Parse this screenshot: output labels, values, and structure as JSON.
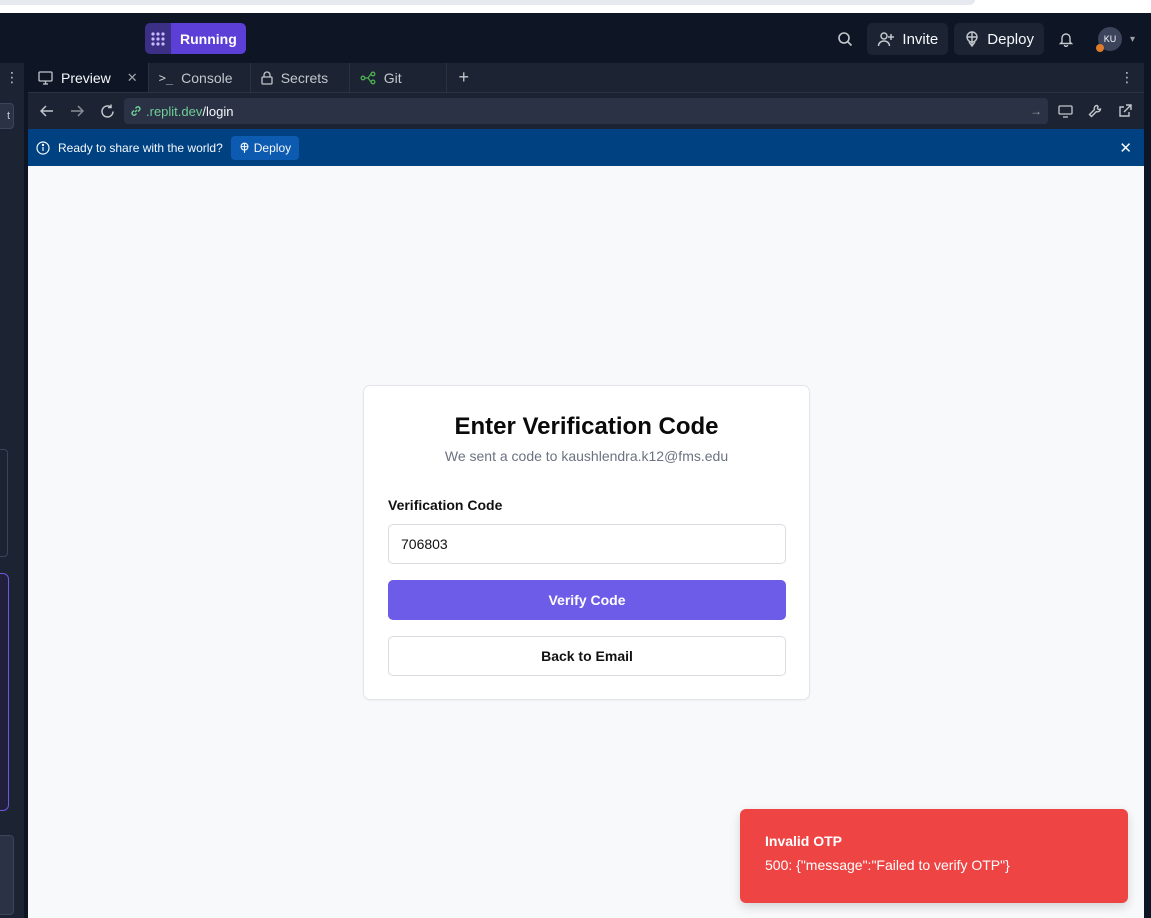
{
  "header": {
    "run_label": "Running",
    "invite_label": "Invite",
    "deploy_label": "Deploy",
    "avatar_initials": "KU"
  },
  "tabs": [
    {
      "label": "Preview",
      "icon": "monitor-icon"
    },
    {
      "label": "Console",
      "icon": "terminal-icon"
    },
    {
      "label": "Secrets",
      "icon": "lock-icon"
    },
    {
      "label": "Git",
      "icon": "git-icon"
    }
  ],
  "url": {
    "host": ".replit.dev",
    "path": "/login"
  },
  "banner": {
    "text": "Ready to share with the world?",
    "deploy_label": "Deploy"
  },
  "card": {
    "title": "Enter Verification Code",
    "subtitle": "We sent a code to kaushlendra.k12@fms.edu",
    "field_label": "Verification Code",
    "field_value": "706803",
    "verify_label": "Verify Code",
    "back_label": "Back to Email"
  },
  "toast": {
    "title": "Invalid OTP",
    "message": "500: {\"message\":\"Failed to verify OTP\"}"
  },
  "colors": {
    "accent": "#6c5ce7",
    "toast_bg": "#ef4444",
    "banner_bg": "#004182"
  }
}
